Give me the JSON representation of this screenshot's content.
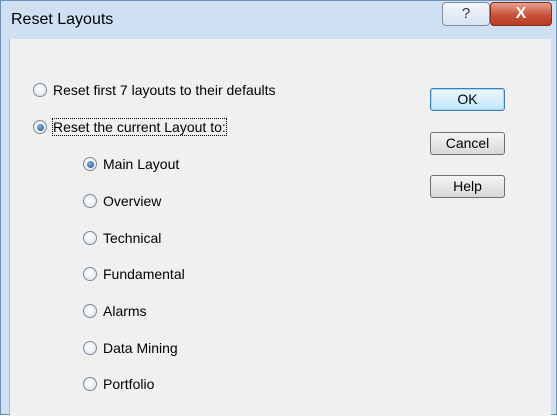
{
  "window": {
    "title": "Reset Layouts",
    "help_glyph": "?",
    "close_glyph": "X"
  },
  "options": {
    "reset_first": "Reset first 7 layouts to their defaults",
    "reset_current": "Reset the current Layout to:",
    "selected": "reset_current"
  },
  "layouts": {
    "items": [
      "Main Layout",
      "Overview",
      "Technical",
      "Fundamental",
      "Alarms",
      "Data Mining",
      "Portfolio"
    ],
    "selected": "Main Layout"
  },
  "buttons": {
    "ok": "OK",
    "cancel": "Cancel",
    "help": "Help"
  }
}
